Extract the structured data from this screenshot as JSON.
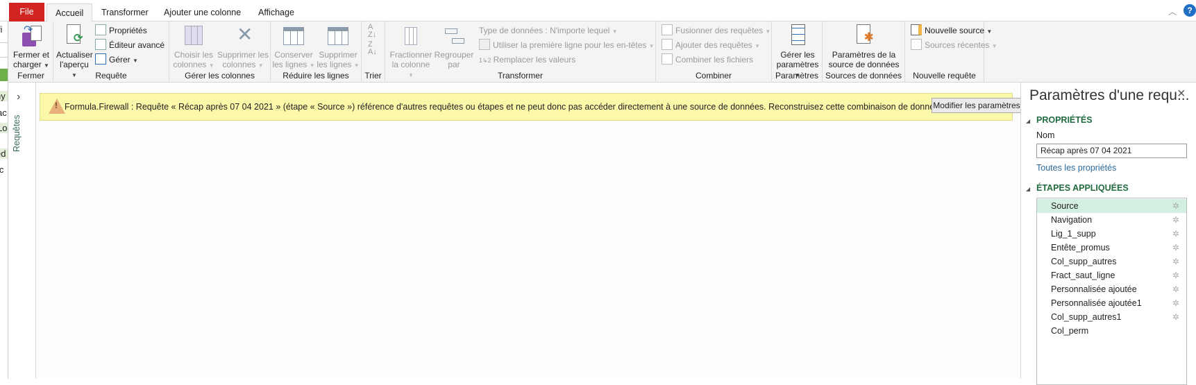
{
  "tabs": [
    "File",
    "Accueil",
    "Transformer",
    "Ajouter une colonne",
    "Affichage"
  ],
  "ribbon": {
    "fermer": {
      "button": "Fermer et",
      "button2": "charger",
      "label": "Fermer"
    },
    "requete": {
      "actualiser": "Actualiser",
      "actualiser2": "l'aperçu",
      "proprietes": "Propriétés",
      "editeur": "Éditeur avancé",
      "gerer": "Gérer",
      "label": "Requête"
    },
    "colonnes": {
      "choisir": "Choisir les",
      "choisir2": "colonnes",
      "supprimer": "Supprimer les",
      "supprimer2": "colonnes",
      "label": "Gérer les colonnes"
    },
    "lignes": {
      "conserver": "Conserver",
      "conserver2": "les lignes",
      "supprimer": "Supprimer",
      "supprimer2": "les lignes",
      "label": "Réduire les lignes"
    },
    "trier": {
      "label": "Trier"
    },
    "transformer": {
      "fractionner": "Fractionner",
      "fractionner2": "la colonne",
      "regrouper": "Regrouper",
      "regrouper2": "par",
      "type": "Type de données : N'importe lequel",
      "premiere": "Utiliser la première ligne pour les en-têtes",
      "remplacer": "Remplacer les valeurs",
      "label": "Transformer"
    },
    "combiner": {
      "fusionner": "Fusionner des requêtes",
      "ajouter": "Ajouter des requêtes",
      "combiner": "Combiner les fichiers",
      "label": "Combiner"
    },
    "parametres": {
      "gerer": "Gérer les",
      "gerer2": "paramètres",
      "label": "Paramètres"
    },
    "sources": {
      "param": "Paramètres de la",
      "param2": "source de données",
      "label": "Sources de données"
    },
    "nouvelle": {
      "source": "Nouvelle source",
      "recentes": "Sources récentes",
      "label": "Nouvelle requête"
    }
  },
  "excel_fragments": [
    "ifi",
    "ny",
    "ac",
    "Lo",
    "ed",
    "ic"
  ],
  "queries_pane": {
    "label": "Requêtes"
  },
  "warning": {
    "message": "Formula.Firewall : Requête « Récap après 07 04 2021 » (étape « Source ») référence d'autres requêtes ou étapes et ne peut donc pas accéder directement à une source de données. Reconstruisez cette combinaison de données.",
    "button": "Modifier les paramètres"
  },
  "settings": {
    "title": "Paramètres d'une requ...",
    "properties": "PROPRIÉTÉS",
    "name_label": "Nom",
    "name_value": "Récap après 07 04 2021",
    "all_props": "Toutes les propriétés",
    "steps_title": "ÉTAPES APPLIQUÉES",
    "steps": [
      "Source",
      "Navigation",
      "Lig_1_supp",
      "Entête_promus",
      "Col_supp_autres",
      "Fract_saut_ligne",
      "Personnalisée ajoutée",
      "Personnalisée ajoutée1",
      "Col_supp_autres1",
      "Col_perm"
    ]
  },
  "colors": {
    "file": "#d22420",
    "section": "#216b3e",
    "warning_bg": "#fbf8a9",
    "selected_step": "#d3efe2"
  }
}
